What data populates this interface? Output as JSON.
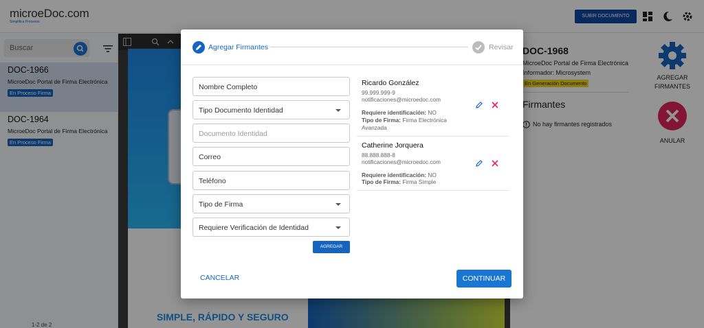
{
  "header": {
    "logo": "microeDoc.com",
    "logo_tagline": "Simplifica Procesos",
    "upload_label": "SUBIR DOCUMENTO"
  },
  "sidebar": {
    "search_placeholder": "Buscar",
    "documents": [
      {
        "code": "DOC-1966",
        "desc": "MicroeDoc Portal de Firma Electrónica",
        "status": "En Proceso Firma",
        "selected": true
      },
      {
        "code": "DOC-1964",
        "desc": "MicroeDoc Portal de Firma Electrónica",
        "status": "En Proceso Firma",
        "selected": false
      }
    ],
    "pager": "1-2 de 2"
  },
  "viewer": {
    "slogan": "SIMPLE, RÁPIDO Y SEGURO"
  },
  "details": {
    "code": "DOC-1968",
    "title": "MicroeDoc Portal de Firma Electrónica",
    "informer": "Informador: Microsystem",
    "status": "En Generación Documento",
    "signers_heading": "Firmantes",
    "no_signers": "No hay firmantes registrados",
    "add_signers": [
      "AGREGAR",
      "FIRMANTES"
    ],
    "cancel_doc": "ANULAR"
  },
  "modal": {
    "step1": "Agregar Firmantes",
    "step2": "Revisar",
    "fields": [
      {
        "label": "Nombre Completo",
        "type": "text",
        "placeholder": false
      },
      {
        "label": "Tipo Documento Identidad",
        "type": "select",
        "placeholder": false
      },
      {
        "label": "Documento Identidad",
        "type": "text",
        "placeholder": true
      },
      {
        "label": "Correo",
        "type": "text",
        "placeholder": false
      },
      {
        "label": "Teléfono",
        "type": "text",
        "placeholder": false
      },
      {
        "label": "Tipo de Firma",
        "type": "select",
        "placeholder": false
      },
      {
        "label": "Requiere Verificación de Identidad",
        "type": "select",
        "placeholder": false
      }
    ],
    "add_label": "AGREGAR",
    "signers": [
      {
        "name": "Ricardo González",
        "id": "99.999.999-9",
        "email": "notificaciones@microedoc.com",
        "req_label": "Requiere identificación:",
        "req_value": "NO",
        "type_label": "Tipo de Firma:",
        "type_value": "Firma Electrónica Avanzada"
      },
      {
        "name": "Catherine Jorquera",
        "id": "88.888.888-8",
        "email": "notificaciones@microedoc.com",
        "req_label": "Requiere identificación:",
        "req_value": "NO",
        "type_label": "Tipo de Firma:",
        "type_value": "Firma Simple"
      }
    ],
    "cancel_label": "CANCELAR",
    "continue_label": "CONTINUAR"
  },
  "colors": {
    "primary": "#1565c0",
    "danger": "#e0245e",
    "badge_yellow": "#f9d71c"
  }
}
